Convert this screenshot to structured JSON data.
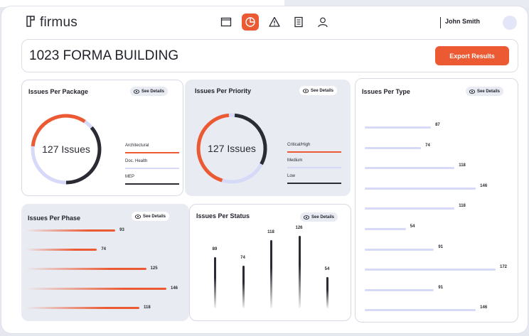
{
  "app": {
    "logo_text": "firmus"
  },
  "nav": [
    {
      "icon": "folder-icon",
      "active": false
    },
    {
      "icon": "pie-chart-icon",
      "active": true
    },
    {
      "icon": "warning-icon",
      "active": false
    },
    {
      "icon": "document-icon",
      "active": false
    },
    {
      "icon": "user-icon",
      "active": false
    }
  ],
  "user": {
    "name": "John Smith"
  },
  "project": {
    "title": "1023 FORMA BUILDING"
  },
  "export_label": "Export Results",
  "see_details_label": "See Details",
  "colors": {
    "accent": "#ec5a33",
    "dark": "#2a2b33",
    "lavender": "#d6d9f7",
    "panel": "#e9ebf3"
  },
  "package": {
    "title": "Issues Per Package",
    "total_label": "127 Issues",
    "legend": [
      "Architectural",
      "Doc. Health",
      "MEP"
    ]
  },
  "priority": {
    "title": "Issues Per Priority",
    "total_label": "127 Issues",
    "legend": [
      "Critical/High",
      "Medium",
      "Low"
    ]
  },
  "type": {
    "title": "Issues Per Type",
    "values": [
      "87",
      "74",
      "118",
      "146",
      "118",
      "54",
      "91",
      "172",
      "91",
      "146"
    ]
  },
  "phase": {
    "title": "Issues Per Phase",
    "values": [
      "93",
      "74",
      "125",
      "146",
      "118"
    ]
  },
  "status": {
    "title": "Issues Per Status",
    "values": [
      "89",
      "74",
      "118",
      "126",
      "54"
    ]
  },
  "chart_data": [
    {
      "type": "bar",
      "title": "Issues Per Type",
      "orientation": "horizontal",
      "values": [
        87,
        74,
        118,
        146,
        118,
        54,
        91,
        172,
        91,
        146
      ]
    },
    {
      "type": "bar",
      "title": "Issues Per Phase",
      "orientation": "horizontal",
      "values": [
        93,
        74,
        125,
        146,
        118
      ]
    },
    {
      "type": "bar",
      "title": "Issues Per Status",
      "orientation": "vertical",
      "values": [
        89,
        74,
        118,
        126,
        54
      ]
    }
  ]
}
